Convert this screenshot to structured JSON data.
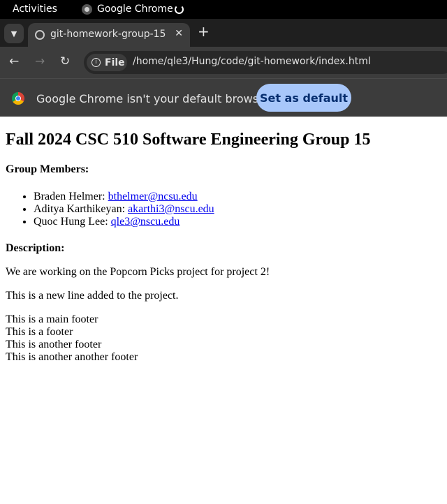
{
  "topbar": {
    "activities": "Activities",
    "app_name": "Google Chrome"
  },
  "tabs": {
    "active_title": "git-homework-group-15"
  },
  "toolbar": {
    "chip_label": "File",
    "url": "/home/qle3/Hung/code/git-homework/index.html"
  },
  "infobar": {
    "message": "Google Chrome isn't your default browser",
    "button_label": "Set as default"
  },
  "page": {
    "heading": "Fall 2024 CSC 510 Software Engineering Group 15",
    "members_heading": "Group Members:",
    "members": [
      {
        "name": "Braden Helmer: ",
        "email": "bthelmer@ncsu.edu"
      },
      {
        "name": "Aditya Karthikeyan: ",
        "email": "akarthi3@nscu.edu"
      },
      {
        "name": "Quoc Hung Lee: ",
        "email": "qle3@nscu.edu"
      }
    ],
    "description_heading": "Description:",
    "description": "We are working on the Popcorn Picks project for project 2!",
    "new_line": "This is a new line added to the project.",
    "footers": [
      "This is a main footer",
      "This is a footer",
      "This is another footer",
      "This is another another footer"
    ]
  }
}
